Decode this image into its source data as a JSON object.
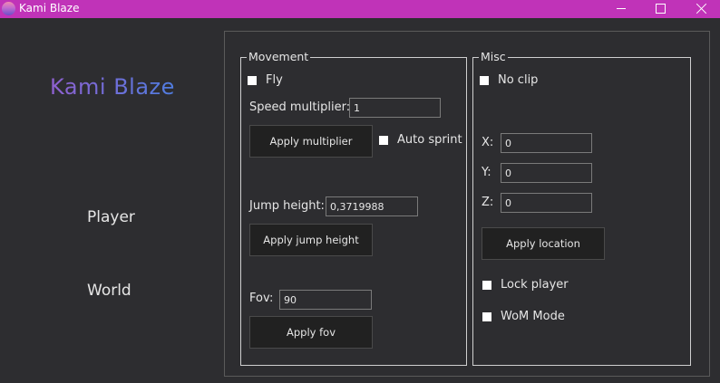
{
  "window": {
    "title": "Kami Blaze"
  },
  "sidebar": {
    "logo": "Kami Blaze",
    "items": [
      {
        "label": "Player"
      },
      {
        "label": "World"
      }
    ]
  },
  "movement": {
    "legend": "Movement",
    "fly_label": "Fly",
    "speed_label": "Speed multiplier:",
    "speed_value": "1",
    "apply_multiplier": "Apply multiplier",
    "auto_sprint_label": "Auto sprint",
    "jump_label": "Jump height:",
    "jump_value": "0,3719988",
    "apply_jump": "Apply jump height",
    "fov_label": "Fov:",
    "fov_value": "90",
    "apply_fov": "Apply fov"
  },
  "misc": {
    "legend": "Misc",
    "noclip_label": "No clip",
    "x_label": "X:",
    "x_value": "0",
    "y_label": "Y:",
    "y_value": "0",
    "z_label": "Z:",
    "z_value": "0",
    "apply_location": "Apply location",
    "lock_player_label": "Lock player",
    "wom_mode_label": "WoM Mode"
  }
}
